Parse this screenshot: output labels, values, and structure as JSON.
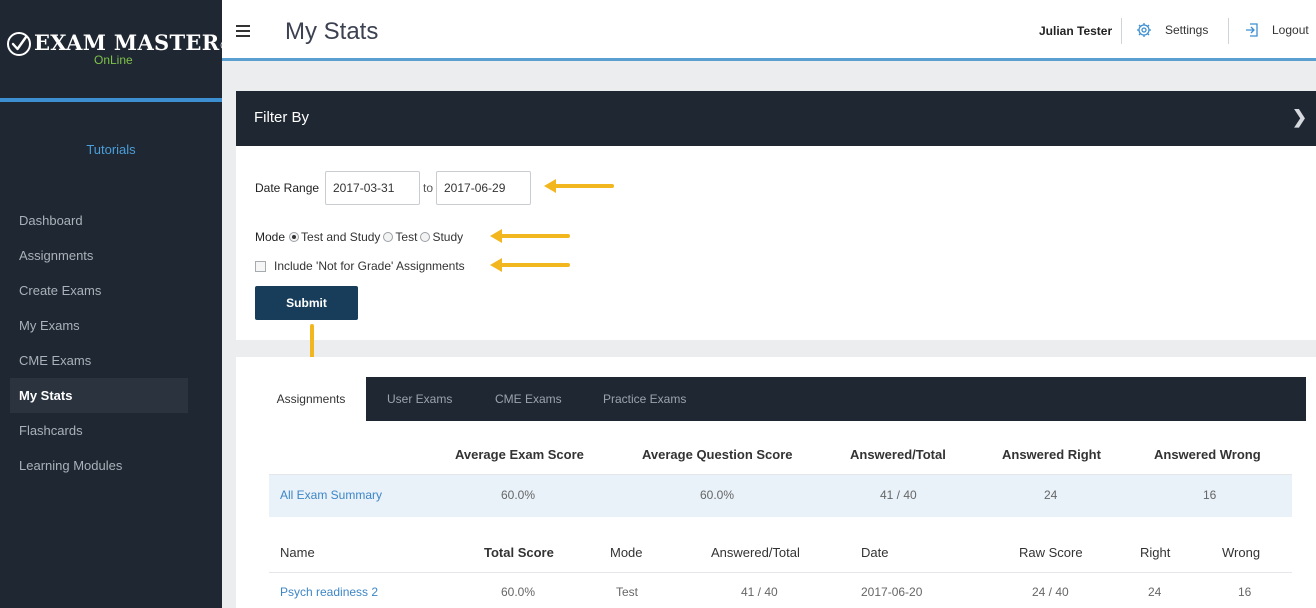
{
  "app": {
    "logo_text": "EXAM MASTER",
    "logo_reg": "®",
    "logo_sub": "OnLine"
  },
  "sidebar": {
    "tutorials": "Tutorials",
    "items": [
      {
        "label": "Dashboard"
      },
      {
        "label": "Assignments"
      },
      {
        "label": "Create Exams"
      },
      {
        "label": "My Exams"
      },
      {
        "label": "CME Exams"
      },
      {
        "label": "My Stats",
        "active": true
      },
      {
        "label": "Flashcards"
      },
      {
        "label": "Learning Modules"
      }
    ]
  },
  "header": {
    "title": "My Stats",
    "user": "Julian Tester",
    "settings": "Settings",
    "logout": "Logout"
  },
  "filter": {
    "title": "Filter By",
    "date_label": "Date Range",
    "date_from": "2017-03-31",
    "date_to_label": "to",
    "date_to": "2017-06-29",
    "mode_label": "Mode",
    "modes": [
      "Test and Study",
      "Test",
      "Study"
    ],
    "mode_selected": "Test and Study",
    "not_for_grade": "Include 'Not for Grade' Assignments",
    "submit": "Submit"
  },
  "tabs": [
    {
      "label": "Assignments",
      "active": true
    },
    {
      "label": "User Exams"
    },
    {
      "label": "CME Exams"
    },
    {
      "label": "Practice Exams"
    }
  ],
  "summary": {
    "headers": [
      "Average Exam Score",
      "Average Question Score",
      "Answered/Total",
      "Answered Right",
      "Answered Wrong"
    ],
    "row": {
      "name": "All Exam Summary",
      "avg_exam": "60.0%",
      "avg_question": "60.0%",
      "answered_total": "41 / 40",
      "right": "24",
      "wrong": "16"
    }
  },
  "details": {
    "headers": [
      "Name",
      "Total Score",
      "Mode",
      "Answered/Total",
      "Date",
      "Raw Score",
      "Right",
      "Wrong"
    ],
    "rows": [
      {
        "name": "Psych readiness 2",
        "total_score": "60.0%",
        "mode": "Test",
        "answered_total": "41 / 40",
        "date": "2017-06-20",
        "raw_score": "24 / 40",
        "right": "24",
        "wrong": "16"
      }
    ]
  },
  "colors": {
    "sidebar_bg": "#1f2732",
    "accent_blue": "#3c8fd1",
    "logo_green": "#7fc24a",
    "annotation_arrow": "#f2b61e",
    "submit_bg": "#173d5b",
    "link": "#3d86c6"
  },
  "icons": {
    "menu": "hamburger-icon",
    "settings": "gear-icon",
    "logout": "logout-icon",
    "logo": "checkmark-circle-icon",
    "panel_toggle": "chevron-right-icon"
  }
}
